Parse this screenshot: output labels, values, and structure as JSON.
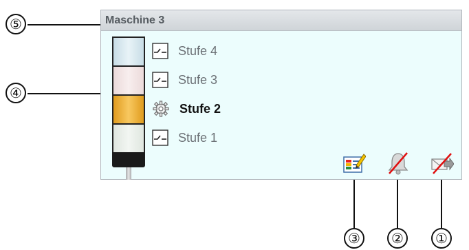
{
  "panel": {
    "title": "Maschine 3",
    "stages": [
      {
        "label": "Stufe 4",
        "active": false,
        "icon": "switch-open-icon"
      },
      {
        "label": "Stufe 3",
        "active": false,
        "icon": "switch-open-icon"
      },
      {
        "label": "Stufe 2",
        "active": true,
        "icon": "gear-icon"
      },
      {
        "label": "Stufe 1",
        "active": false,
        "icon": "switch-open-icon"
      }
    ],
    "tower_colors": {
      "stage_4": "#e1eef3",
      "stage_3": "#f3e6e6",
      "stage_2": "#f2b33a",
      "stage_1": "#edf2ed"
    },
    "actions": [
      {
        "name": "edit-colors-button",
        "icon": "color-edit-icon"
      },
      {
        "name": "alarm-disabled-button",
        "icon": "bell-disabled-icon"
      },
      {
        "name": "message-disabled-button",
        "icon": "mail-forward-disabled-icon"
      }
    ]
  },
  "callouts": {
    "one": "①",
    "two": "②",
    "three": "③",
    "four": "④",
    "five": "⑤"
  }
}
